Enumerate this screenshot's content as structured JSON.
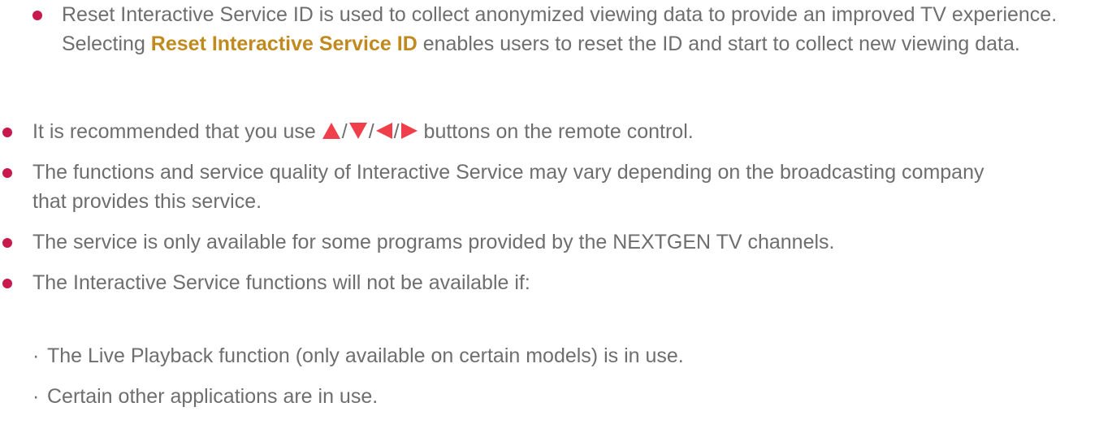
{
  "colors": {
    "bullet": "#c8194d",
    "highlight": "#c18a1e",
    "text": "#6e6e6e",
    "arrow": "#ef3f4a"
  },
  "sub_item": {
    "before": "Reset Interactive Service ID is used to collect anonymized viewing data to provide an improved TV experience. Selecting ",
    "highlight": "Reset Interactive Service ID",
    "after": " enables users to reset the ID and start to collect new viewing data."
  },
  "bullets": {
    "b1_before": "It is recommended that you use ",
    "b1_sep1": "/",
    "b1_sep2": "/",
    "b1_sep3": "/",
    "b1_after": " buttons on the remote control.",
    "b2": "The functions and service quality of Interactive Service may vary depending on the broadcasting company that provides this service.",
    "b3": "The service is only available for some programs provided by the NEXTGEN TV channels.",
    "b4": "The Interactive Service functions will not be available if:"
  },
  "sub_bullets": {
    "dot": "·",
    "s1": "The Live Playback function (only available on certain models) is in use.",
    "s2": "Certain other applications are in use."
  },
  "icons": [
    "up-arrow-icon",
    "down-arrow-icon",
    "left-arrow-icon",
    "right-arrow-icon"
  ]
}
